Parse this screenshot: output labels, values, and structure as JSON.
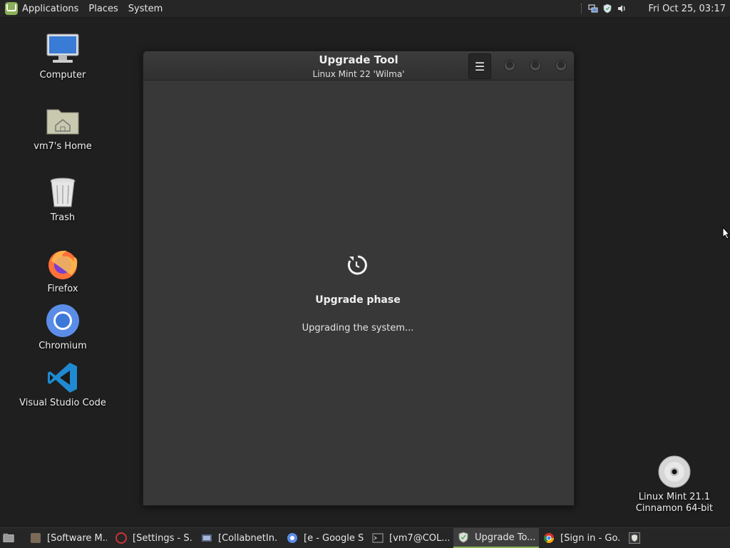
{
  "top_panel": {
    "menus": [
      "Applications",
      "Places",
      "System"
    ],
    "clock": "Fri Oct 25, 03:17",
    "tray_icons": [
      "network-icon",
      "shield-update-icon",
      "volume-icon"
    ]
  },
  "desktop_icons": [
    {
      "label": "Computer",
      "icon": "computer-icon"
    },
    {
      "label": "vm7's Home",
      "icon": "home-folder-icon"
    },
    {
      "label": "Trash",
      "icon": "trash-icon"
    },
    {
      "label": "Firefox",
      "icon": "firefox-icon"
    },
    {
      "label": "Chromium",
      "icon": "chromium-icon"
    },
    {
      "label": "Visual Studio Code",
      "icon": "vscode-icon"
    },
    {
      "label": "Linux Mint 21.1\nCinnamon 64-bit",
      "icon": "disc-icon"
    }
  ],
  "window": {
    "title": "Upgrade Tool",
    "subtitle": "Linux Mint 22 'Wilma'",
    "menu_glyph": "☰",
    "phase_title": "Upgrade phase",
    "phase_text": "Upgrading the system..."
  },
  "taskbar": {
    "items": [
      {
        "label": "[Software M...",
        "icon": "software-manager-icon",
        "active": false
      },
      {
        "label": "[Settings - S...",
        "icon": "settings-icon",
        "active": false
      },
      {
        "label": "[CollabnetIn...",
        "icon": "app-icon",
        "active": false
      },
      {
        "label": "[e - Google S...",
        "icon": "chromium-icon",
        "active": false
      },
      {
        "label": "[vm7@COL...",
        "icon": "terminal-icon",
        "active": false
      },
      {
        "label": "Upgrade To...",
        "icon": "shield-icon",
        "active": true
      },
      {
        "label": "[Sign in - Go...",
        "icon": "chrome-icon",
        "active": false
      }
    ]
  },
  "colors": {
    "mint_green": "#8bb158",
    "panel_bg": "#262626",
    "window_bg": "#383838",
    "desktop_bg": "#1f1f1f"
  }
}
